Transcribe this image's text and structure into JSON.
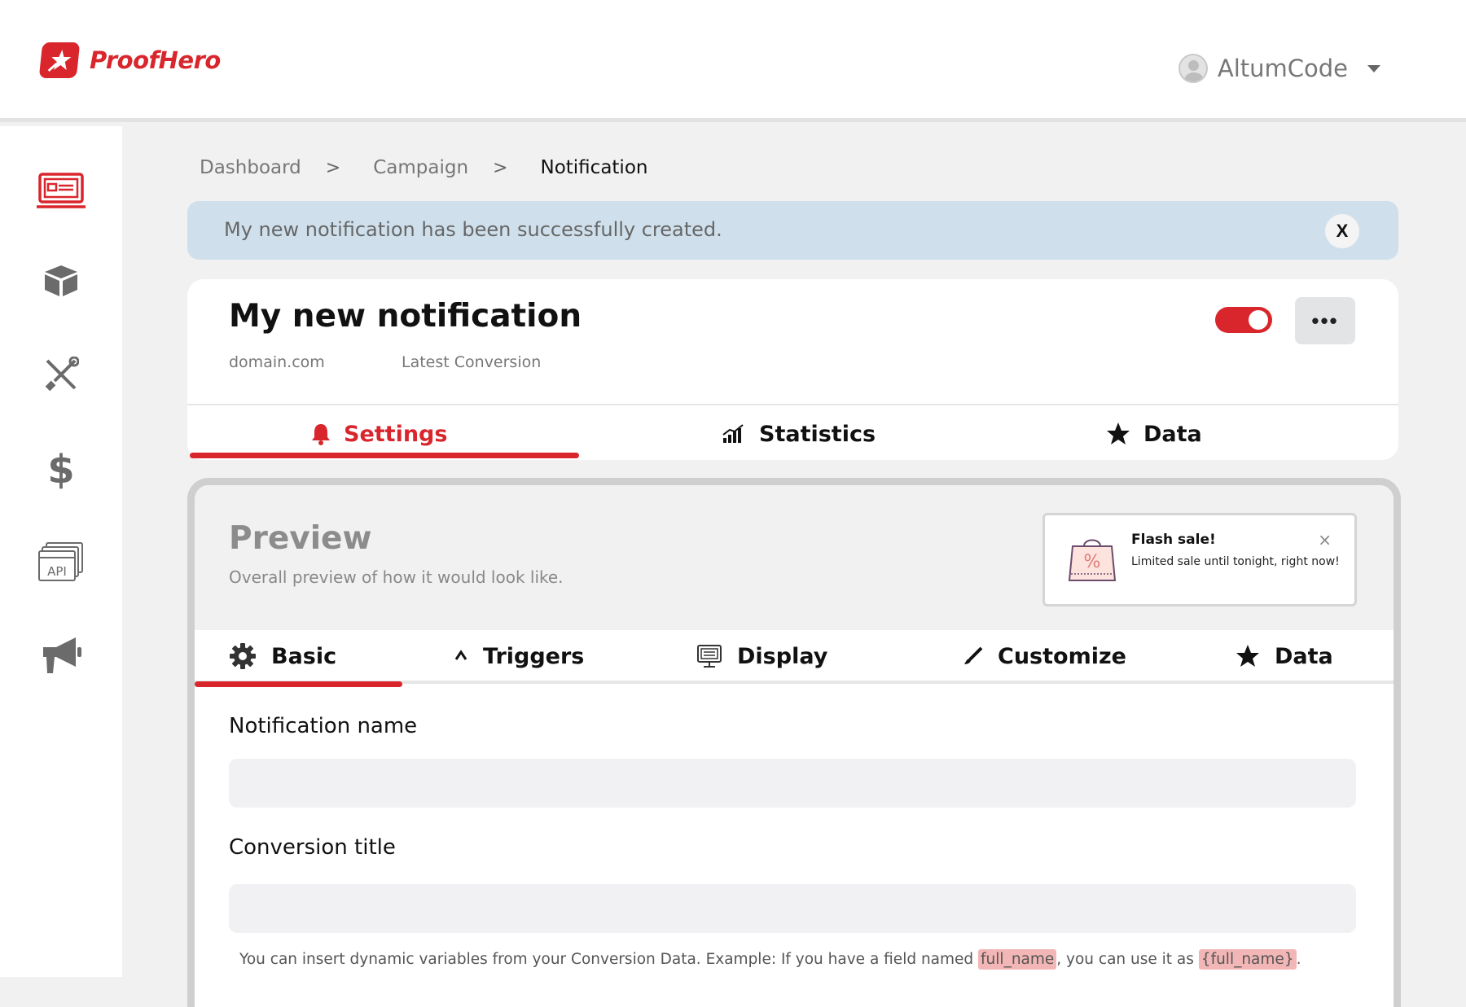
{
  "brand": {
    "name": "ProofHero",
    "color": "#d9262c"
  },
  "user": {
    "name": "AltumCode"
  },
  "sidebar": {
    "items": [
      {
        "icon": "campaigns-icon",
        "active": true
      },
      {
        "icon": "package-icon",
        "active": false
      },
      {
        "icon": "tools-icon",
        "active": false
      },
      {
        "icon": "dollar-icon",
        "active": false
      },
      {
        "icon": "api-icon",
        "active": false
      },
      {
        "icon": "megaphone-icon",
        "active": false
      }
    ]
  },
  "breadcrumb": {
    "items": [
      "Dashboard",
      "Campaign",
      "Notification"
    ],
    "separator": ">"
  },
  "alert": {
    "message": "My new notification has been successfully created.",
    "close_label": "X"
  },
  "notification": {
    "title": "My new notification",
    "domain": "domain.com",
    "type": "Latest Conversion",
    "enabled": true,
    "more_label": "•••"
  },
  "main_tabs": [
    {
      "label": "Settings",
      "icon": "bell-icon",
      "active": true
    },
    {
      "label": "Statistics",
      "icon": "bar-chart-icon",
      "active": false
    },
    {
      "label": "Data",
      "icon": "star-icon",
      "active": false
    }
  ],
  "preview": {
    "title": "Preview",
    "subtitle": "Overall preview of how it would look like.",
    "toast": {
      "title": "Flash sale!",
      "text": "Limited sale until tonight, right now!",
      "close": "×",
      "icon": "shopping-bag-percent-icon"
    }
  },
  "sub_tabs": [
    {
      "label": "Basic",
      "icon": "gear-icon",
      "active": true
    },
    {
      "label": "Triggers",
      "icon": "caret-up-icon",
      "active": false
    },
    {
      "label": "Display",
      "icon": "monitor-icon",
      "active": false
    },
    {
      "label": "Customize",
      "icon": "brush-icon",
      "active": false
    },
    {
      "label": "Data",
      "icon": "star-icon",
      "active": false
    }
  ],
  "form": {
    "fields": [
      {
        "label": "Notification name",
        "value": ""
      },
      {
        "label": "Conversion title",
        "value": ""
      }
    ],
    "help": {
      "part1": "You can insert dynamic variables from your Conversion Data. Example: If you have a field named ",
      "code1": "full_name",
      "part2": ", you can use it as ",
      "code2": "{full_name}",
      "part3": "."
    }
  }
}
